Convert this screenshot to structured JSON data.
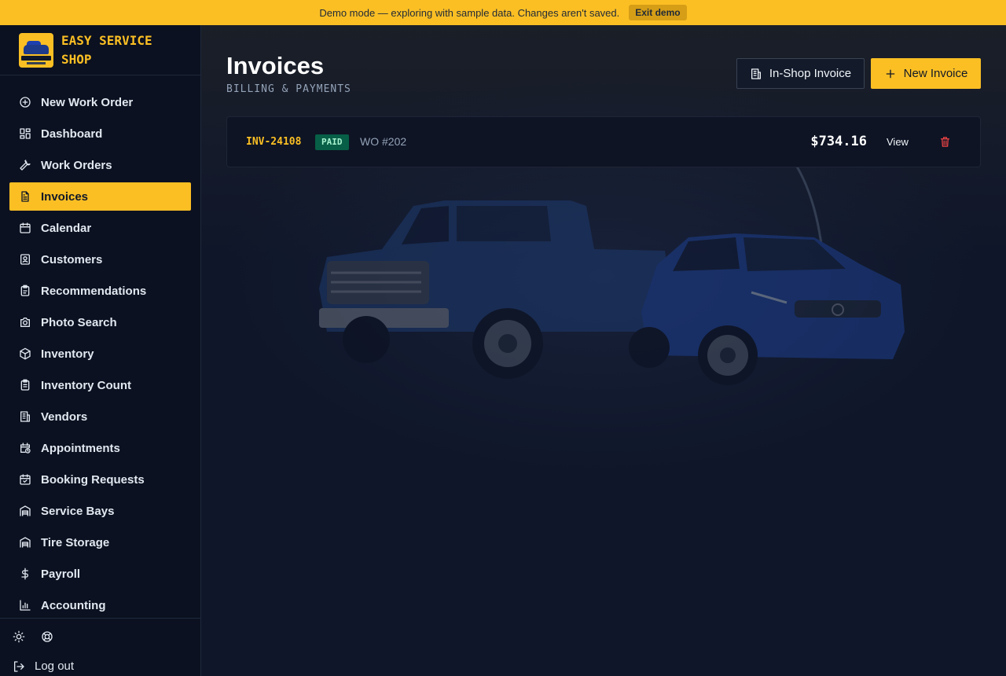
{
  "banner": {
    "message": "Demo mode — exploring with sample data. Changes aren't saved.",
    "exit_label": "Exit demo"
  },
  "brand": {
    "name": "EASY SERVICE SHOP"
  },
  "sidebar": {
    "items": [
      {
        "label": "New Work Order",
        "icon": "plus-circle-icon"
      },
      {
        "label": "Dashboard",
        "icon": "dashboard-icon"
      },
      {
        "label": "Work Orders",
        "icon": "wrench-icon"
      },
      {
        "label": "Invoices",
        "icon": "document-icon",
        "active": true
      },
      {
        "label": "Calendar",
        "icon": "calendar-icon"
      },
      {
        "label": "Customers",
        "icon": "contact-icon"
      },
      {
        "label": "Recommendations",
        "icon": "clipboard-icon"
      },
      {
        "label": "Photo Search",
        "icon": "camera-icon"
      },
      {
        "label": "Inventory",
        "icon": "box-icon"
      },
      {
        "label": "Inventory Count",
        "icon": "clipboard-list-icon"
      },
      {
        "label": "Vendors",
        "icon": "building-icon"
      },
      {
        "label": "Appointments",
        "icon": "calendar-clock-icon"
      },
      {
        "label": "Booking Requests",
        "icon": "calendar-check-icon"
      },
      {
        "label": "Service Bays",
        "icon": "warehouse-icon"
      },
      {
        "label": "Tire Storage",
        "icon": "warehouse-icon"
      },
      {
        "label": "Payroll",
        "icon": "dollar-icon"
      },
      {
        "label": "Accounting",
        "icon": "bar-chart-icon"
      }
    ],
    "logout_label": "Log out"
  },
  "header": {
    "title": "Invoices",
    "subtitle": "BILLING & PAYMENTS",
    "inshop_label": "In-Shop Invoice",
    "new_label": "New Invoice"
  },
  "invoices": [
    {
      "number": "INV-24108",
      "status": "PAID",
      "work_order": "WO #202",
      "amount": "$734.16",
      "view_label": "View"
    }
  ],
  "colors": {
    "accent": "#fbbf24",
    "background": "#0f1629",
    "sidebar": "#0b1120",
    "paid_badge": "#065f46",
    "delete": "#ef4444"
  }
}
